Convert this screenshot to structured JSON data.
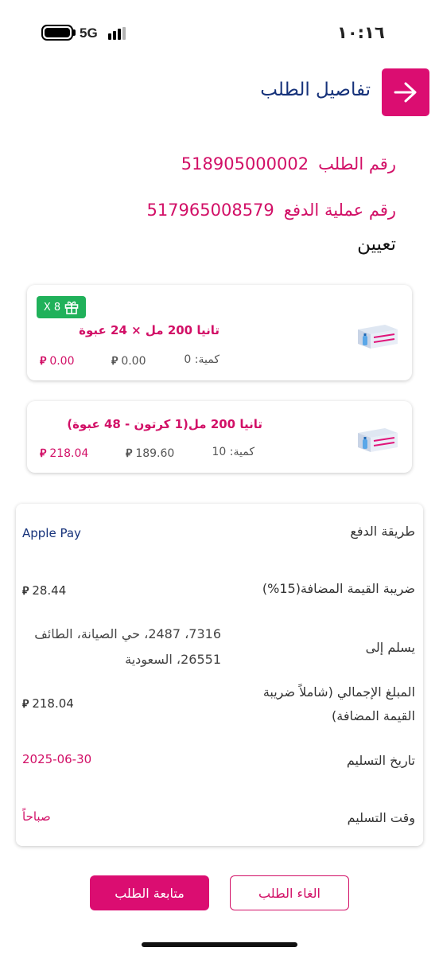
{
  "status_bar": {
    "time": "١٠:١٦",
    "network": "5G"
  },
  "header": {
    "title": "تفاصيل الطلب",
    "back_icon": "arrow-right-icon"
  },
  "order": {
    "order_number_label": "رقم الطلب",
    "order_number": "518905000002",
    "payment_id_label": "رقم عملية الدفع",
    "payment_id": "517965008579",
    "assign_label": "تعيين"
  },
  "currency_symbol": "⃁",
  "items": [
    {
      "name": "تانيا 200 مل  × 24 عبوة",
      "qty_label": "كمية: 0",
      "unit_price": "0.00",
      "total": "0.00",
      "gift_badge": "X 8",
      "gift_icon": "gift-icon"
    },
    {
      "name": "تانيا 200 مل(1 كرتون - 48 عبوة)",
      "qty_label": "كمية: 10",
      "unit_price": "189.60",
      "total": "218.04"
    }
  ],
  "summary": {
    "payment_method_label": "طريقة الدفع",
    "payment_method": "Apple Pay",
    "vat_label": "ضريبة القيمة المضافة(15%)",
    "vat_amount": "28.44",
    "deliver_to_label": "يسلم إلى",
    "address": "7316، 2487، حي الصيانة، الطائف 26551، السعودية",
    "total_label": "المبلغ الإجمالي (شاملاً ضريبة القيمة المضافة)",
    "total_amount": "218.04",
    "delivery_date_label": "تاريخ التسليم",
    "delivery_date": "2025-06-30",
    "delivery_time_label": "وقت التسليم",
    "delivery_time": "صباحاً"
  },
  "actions": {
    "track_label": "متابعة الطلب",
    "cancel_label": "الغاء الطلب"
  },
  "colors": {
    "brand": "#db0d71",
    "navy": "#16327a",
    "gift": "#20b15a"
  }
}
